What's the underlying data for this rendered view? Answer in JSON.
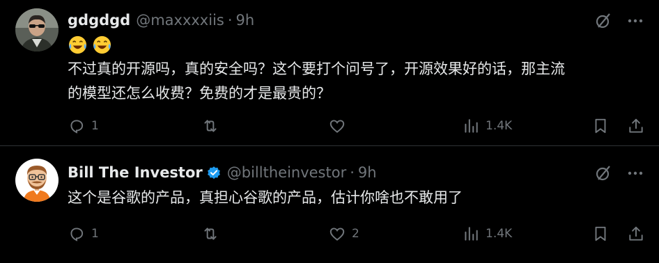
{
  "tweets": [
    {
      "author_name": "gdgdgd",
      "handle": "@maxxxxiis",
      "separator": "·",
      "time": "9h",
      "emojis": [
        "laughing-tears-emoji",
        "laughing-tears-emoji"
      ],
      "text": "不过真的开源吗，真的安全吗？这个要打个问号了，开源效果好的话，那主流\n的模型还怎么收费？免费的才是最贵的？",
      "reply_count": "1",
      "repost_count": "",
      "like_count": "",
      "view_count": "1.4K"
    },
    {
      "author_name": "Bill The Investor",
      "verified": true,
      "handle": "@billtheinvestor",
      "separator": "·",
      "time": "9h",
      "text": "这个是谷歌的产品，真担心谷歌的产品，估计你啥也不敢用了",
      "reply_count": "1",
      "repost_count": "",
      "like_count": "2",
      "view_count": "1.4K"
    }
  ],
  "icons": {
    "grok": "grok-icon",
    "more": "more-icon",
    "reply": "reply-icon",
    "repost": "repost-icon",
    "like": "like-icon",
    "views": "views-icon",
    "bookmark": "bookmark-icon",
    "share": "share-icon"
  },
  "colors": {
    "background": "#000000",
    "text": "#e7e9ea",
    "muted": "#71767b",
    "verified": "#1d9bf0"
  }
}
